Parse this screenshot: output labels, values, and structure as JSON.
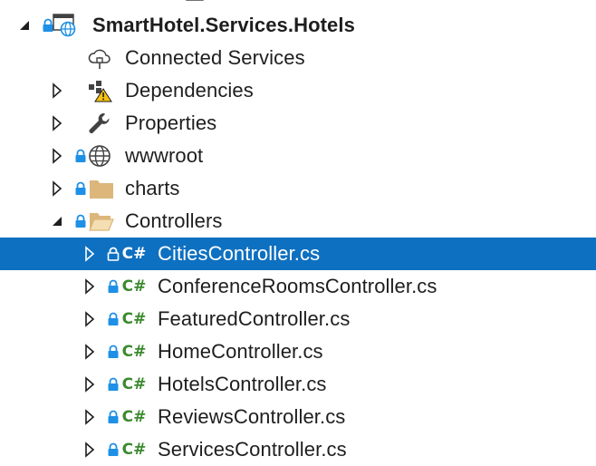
{
  "project": {
    "name": "SmartHotel.Services.Hotels"
  },
  "nodes": {
    "connected_services": "Connected Services",
    "dependencies": "Dependencies",
    "properties": "Properties",
    "wwwroot": "wwwroot",
    "charts": "charts",
    "controllers": "Controllers"
  },
  "files": [
    "CitiesController.cs",
    "ConferenceRoomsController.cs",
    "FeaturedController.cs",
    "HomeController.cs",
    "HotelsController.cs",
    "ReviewsController.cs",
    "ServicesController.cs"
  ],
  "file_badge": "C#",
  "colors": {
    "selection": "#0e70c0",
    "csharp": "#3b8a2f",
    "lock": "#1e90e6",
    "folder": "#dcb67a"
  }
}
